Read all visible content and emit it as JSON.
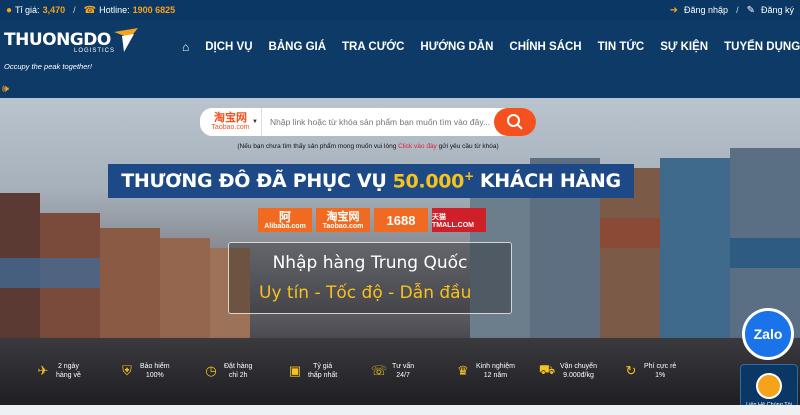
{
  "topbar": {
    "rate_label": "Tỉ giá:",
    "rate_value": "3,470",
    "hotline_label": "Hotline:",
    "hotline_value": "1900 6825",
    "login": "Đăng nhập",
    "register": "Đăng ký"
  },
  "logo": {
    "name": "THUONGDO",
    "sub": "LOGISTICS",
    "tagline": "Occupy the peak together!"
  },
  "nav": [
    "DỊCH VỤ",
    "BẢNG GIÁ",
    "TRA CƯỚC",
    "HƯỚNG DẪN",
    "CHÍNH SÁCH",
    "TIN TỨC",
    "SỰ KIỆN",
    "TUYỂN DỤNG"
  ],
  "search": {
    "source_cn": "淘宝网",
    "source_com": "Taobao.com",
    "placeholder": "Nhập link hoặc từ khóa sản phẩm bạn muốn tìm vào đây...",
    "note_before": "(Nếu bạn chưa tìm thấy sản phẩm mong muốn vui lòng ",
    "note_link": "Click vào đây",
    "note_after": " gửi yêu cầu từ khóa)"
  },
  "banner": {
    "before": "THƯƠNG ĐÔ ĐÃ PHỤC VỤ",
    "number": "50.000",
    "sup": "+",
    "after": "KHÁCH HÀNG"
  },
  "platforms": {
    "alibaba_glyph": "阿",
    "alibaba": "Alibaba.com",
    "taobao_cn": "淘宝网",
    "taobao": "Taobao.com",
    "n1688": "1688",
    "tmall": "天猫 TMALL.COM"
  },
  "box": {
    "line1": "Nhập hàng Trung Quốc",
    "line2": "Uy tín - Tốc độ - Dẫn đầu"
  },
  "features": [
    {
      "icon": "plane-icon",
      "l1": "2 ngày",
      "l2": "hàng về"
    },
    {
      "icon": "shield-icon",
      "l1": "Bảo hiểm",
      "l2": "100%"
    },
    {
      "icon": "clock-icon",
      "l1": "Đặt hàng",
      "l2": "chỉ 2h"
    },
    {
      "icon": "money-icon",
      "l1": "Tỷ giá",
      "l2": "thấp nhất"
    },
    {
      "icon": "phone-icon",
      "l1": "Tư vấn",
      "l2": "24/7"
    },
    {
      "icon": "trophy-icon",
      "l1": "Kinh nghiệm",
      "l2": "12 năm"
    },
    {
      "icon": "truck-icon",
      "l1": "Vận chuyển",
      "l2": "9.000đ/kg"
    },
    {
      "icon": "refresh-icon",
      "l1": "Phí cực rẻ",
      "l2": "1%"
    }
  ],
  "widgets": {
    "zalo": "Zalo",
    "contact": "Liên Hệ Chúng Tôi"
  },
  "colors": {
    "navy": "#0d3a66",
    "accent": "#f6a21c",
    "search_orange": "#f4511e",
    "banner_blue": "#1d4a86"
  }
}
